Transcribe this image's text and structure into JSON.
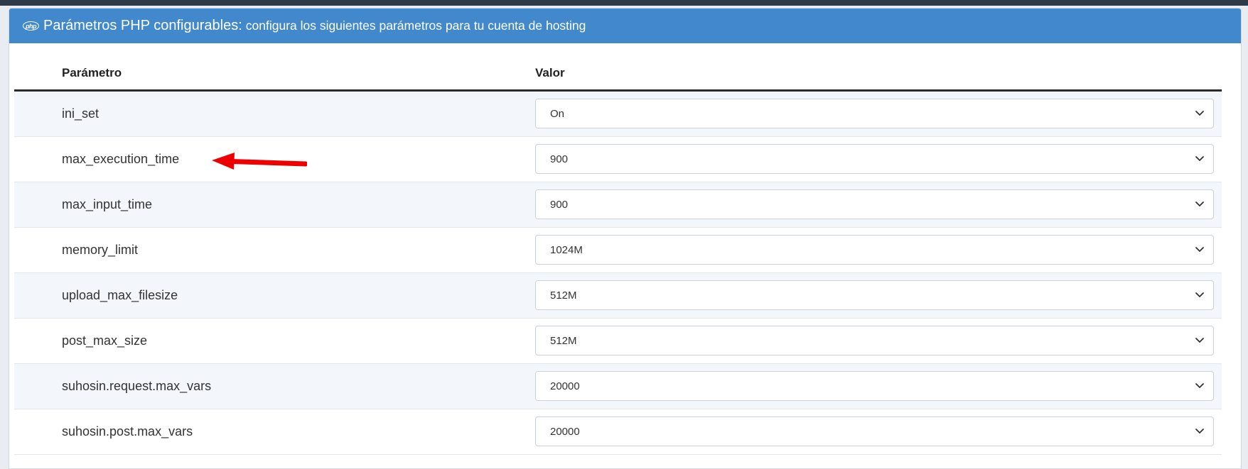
{
  "panel": {
    "icon": "php-icon",
    "icon_text": "php",
    "title": "Parámetros PHP configurables:",
    "subtitle": "configura los siguientes parámetros para tu cuenta de hosting",
    "header_color": "#4189cc"
  },
  "table": {
    "headers": {
      "parameter": "Parámetro",
      "value": "Valor"
    },
    "rows": [
      {
        "name": "ini_set",
        "value": "On"
      },
      {
        "name": "max_execution_time",
        "value": "900"
      },
      {
        "name": "max_input_time",
        "value": "900"
      },
      {
        "name": "memory_limit",
        "value": "1024M"
      },
      {
        "name": "upload_max_filesize",
        "value": "512M"
      },
      {
        "name": "post_max_size",
        "value": "512M"
      },
      {
        "name": "suhosin.request.max_vars",
        "value": "20000"
      },
      {
        "name": "suhosin.post.max_vars",
        "value": "20000"
      }
    ]
  },
  "annotation": {
    "icon": "red-arrow-icon",
    "color": "#ee0000"
  }
}
